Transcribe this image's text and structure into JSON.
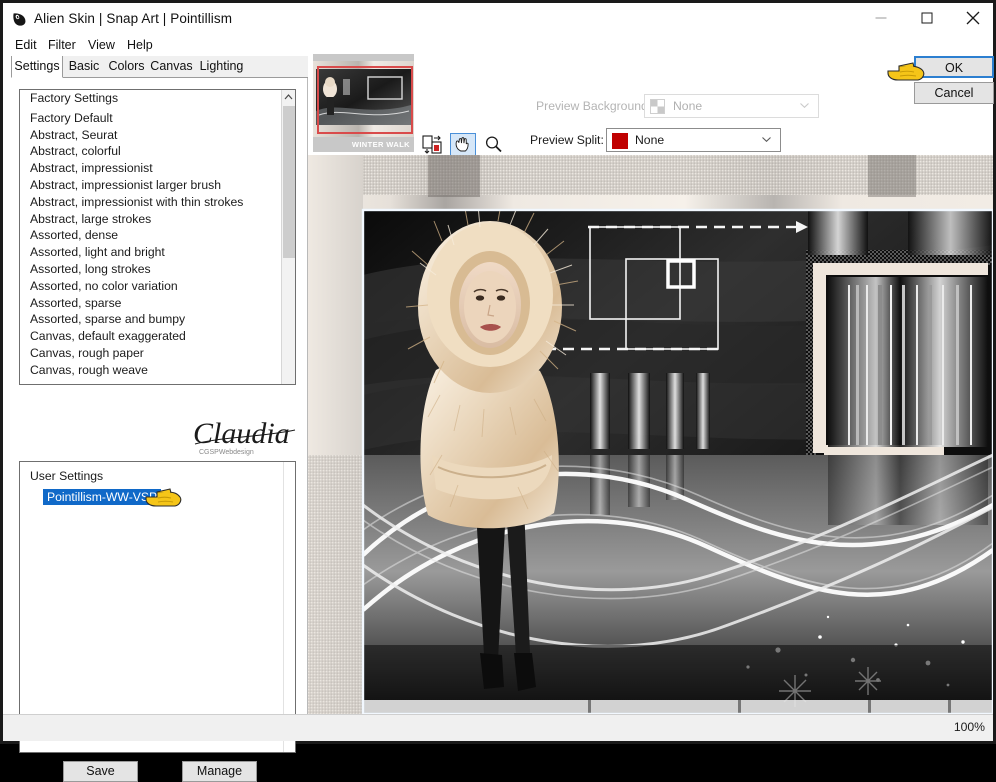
{
  "window": {
    "title": "Alien Skin | Snap Art | Pointillism",
    "app_icon": "alienskin-logo-icon",
    "minimize_label": "—",
    "maximize_label": "□",
    "close_label": "✕"
  },
  "menubar": {
    "items": [
      {
        "label": "Edit"
      },
      {
        "label": "Filter"
      },
      {
        "label": "View"
      },
      {
        "label": "Help"
      }
    ]
  },
  "tabs": [
    {
      "label": "Settings",
      "active": true
    },
    {
      "label": "Basic",
      "active": false
    },
    {
      "label": "Colors",
      "active": false
    },
    {
      "label": "Canvas",
      "active": false
    },
    {
      "label": "Lighting",
      "active": false
    }
  ],
  "factory_settings": {
    "header": "Factory Settings",
    "items": [
      "Factory Default",
      "Abstract, Seurat",
      "Abstract, colorful",
      "Abstract, impressionist",
      "Abstract, impressionist larger brush",
      "Abstract, impressionist with thin strokes",
      "Abstract, large strokes",
      "Assorted, dense",
      "Assorted, light and bright",
      "Assorted, long strokes",
      "Assorted, no color variation",
      "Assorted, sparse",
      "Assorted, sparse and bumpy",
      "Canvas, default exaggerated",
      "Canvas, rough paper",
      "Canvas, rough weave"
    ]
  },
  "watermark": {
    "signature": "Claudia",
    "subtext": "CGSPWebdesign"
  },
  "user_settings": {
    "header": "User Settings",
    "selected": "Pointillism-WW-VSP",
    "pointer_icon": "pointing-hand-cursor-icon"
  },
  "buttons": {
    "save": "Save",
    "manage": "Manage",
    "ok": "OK",
    "cancel": "Cancel"
  },
  "navigator": {
    "caption": "WINTER WALK",
    "viewport_rect_color": "#d94b4b"
  },
  "tools": [
    {
      "name": "fit-to-window-icon",
      "selected": false
    },
    {
      "name": "hand-pan-icon",
      "selected": true
    },
    {
      "name": "zoom-magnifier-icon",
      "selected": false
    }
  ],
  "preview_background": {
    "label": "Preview Background:",
    "value": "None",
    "swatch": "checkerboard-transparent",
    "disabled": true
  },
  "preview_split": {
    "label": "Preview Split:",
    "value": "None",
    "swatch_color": "#c00000",
    "disabled": false
  },
  "statusbar": {
    "zoom": "100%"
  },
  "preview_image": {
    "description": "Winter Walk composite: woman in fur hooded coat on dark abstract background with white squares, dashed arrows, vertical stripe bands and flowing wave curves",
    "border_color": "#e8f4ff"
  }
}
